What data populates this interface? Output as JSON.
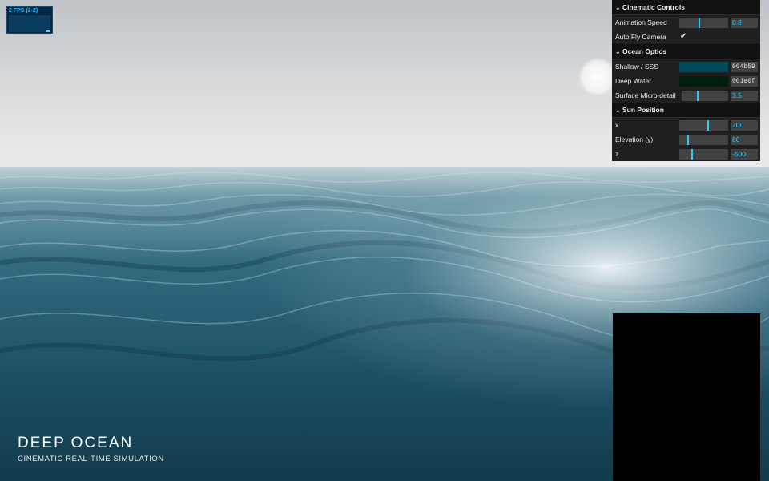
{
  "stats": {
    "label": "2 FPS (2-2)"
  },
  "overlay": {
    "title": "DEEP OCEAN",
    "subtitle": "CINEMATIC REAL-TIME SIMULATION"
  },
  "icons": {
    "chevron": "chevron-down-icon",
    "check": "checkmark-icon"
  },
  "gui": {
    "folders": [
      {
        "title": "Cinematic Controls",
        "controls": [
          {
            "label": "Animation Speed",
            "type": "slider",
            "value": "0.8",
            "fraction": 0.4
          },
          {
            "label": "Auto Fly Camera",
            "type": "checkbox",
            "checked": true
          }
        ]
      },
      {
        "title": "Ocean Optics",
        "controls": [
          {
            "label": "Shallow / SSS",
            "type": "color",
            "hex": "004b59",
            "color": "#004b59"
          },
          {
            "label": "Deep Water",
            "type": "color",
            "hex": "001e0f",
            "color": "#001e0f"
          },
          {
            "label": "Surface Micro-detail",
            "type": "slider",
            "value": "3.5",
            "fraction": 0.32
          }
        ]
      },
      {
        "title": "Sun Position",
        "controls": [
          {
            "label": "x",
            "type": "slider",
            "value": "200",
            "fraction": 0.58
          },
          {
            "label": "Elevation (y)",
            "type": "slider",
            "value": "80",
            "fraction": 0.17
          },
          {
            "label": "z",
            "type": "slider",
            "value": "-500",
            "fraction": 0.25
          }
        ]
      }
    ]
  },
  "colors": {
    "accent": "#2cc9ff",
    "panel": "#1f1f1f",
    "sky": "#e6e7e8",
    "ocean_deep": "#0c2d3a",
    "ocean_mid": "#2f6a7e"
  }
}
